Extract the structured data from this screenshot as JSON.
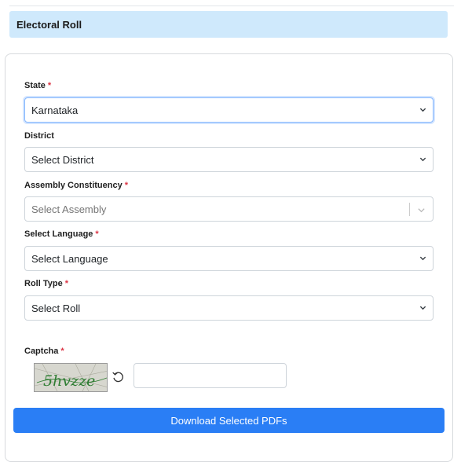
{
  "header": {
    "title": "Electoral Roll"
  },
  "form": {
    "state": {
      "label": "State",
      "required_mark": "*",
      "value": "Karnataka"
    },
    "district": {
      "label": "District",
      "value": "Select District"
    },
    "assembly": {
      "label": "Assembly Constituency",
      "required_mark": "*",
      "placeholder": "Select Assembly"
    },
    "language": {
      "label": "Select Language",
      "required_mark": "*",
      "value": "Select Language"
    },
    "roll_type": {
      "label": "Roll Type",
      "required_mark": "*",
      "value": "Select Roll"
    },
    "captcha": {
      "label": "Captcha",
      "required_mark": "*",
      "image_text": "5hvzze",
      "input_value": ""
    },
    "download_button": "Download Selected PDFs"
  },
  "icons": {
    "select_arrow": "chevron-down-icon",
    "captcha_refresh": "refresh-icon"
  },
  "colors": {
    "header_bg": "#cfe9fc",
    "button_bg": "#2a7ef5",
    "required": "#dc3545",
    "captcha_text": "#2e7d32"
  }
}
